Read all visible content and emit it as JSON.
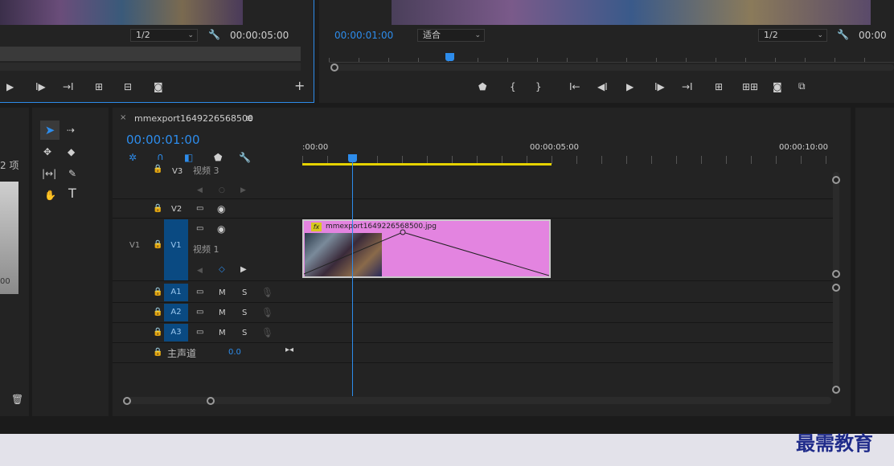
{
  "source_monitor": {
    "resolution": "1/2",
    "timecode": "00:00:05:00",
    "add_label": "+"
  },
  "program_monitor": {
    "timecode": "00:00:01:00",
    "fit": "适合",
    "resolution": "1/2",
    "timecode_right": "00:00"
  },
  "project_panel": {
    "items_count": "2 项",
    "partial_label": "00"
  },
  "timeline": {
    "tab_close": "×",
    "sequence_name": "mmexport1649226568500",
    "menu_icon": "≡",
    "timecode": "00:00:01:00",
    "ruler": [
      ":00:00",
      "00:00:05:00",
      "00:00:10:00"
    ],
    "tracks": {
      "v3": {
        "label": "V3",
        "name": "视频 3"
      },
      "v2": {
        "label": "V2"
      },
      "v1": {
        "src_label": "V1",
        "label": "V1",
        "name": "视频 1"
      },
      "a1": {
        "label": "A1",
        "m": "M",
        "s": "S"
      },
      "a2": {
        "label": "A2",
        "m": "M",
        "s": "S"
      },
      "a3": {
        "label": "A3",
        "m": "M",
        "s": "S"
      },
      "master": {
        "name": "主声道",
        "value": "0.0"
      }
    },
    "clip": {
      "fx": "fx",
      "name": "mmexport1649226568500.jpg",
      "color": "#e384e0"
    }
  },
  "watermark": "最需教育",
  "colors": {
    "accent": "#2d8ceb",
    "track_target": "#0a4a82",
    "work_area": "#e6d300"
  }
}
